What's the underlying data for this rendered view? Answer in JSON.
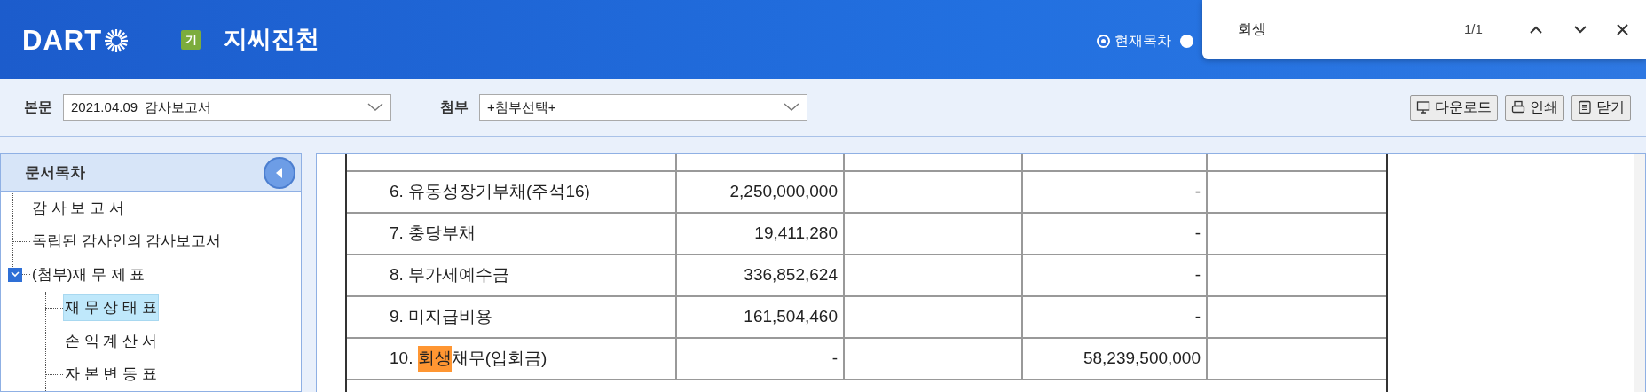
{
  "header": {
    "logo": "DART",
    "badge": "기",
    "company": "지씨진천",
    "toc_options": [
      {
        "label": "현재목차",
        "selected": true
      },
      {
        "selected": false
      }
    ]
  },
  "find_bar": {
    "query": "회생",
    "count": "1/1"
  },
  "toolbar": {
    "main_label": "본문",
    "main_value": "2021.04.09  감사보고서",
    "attach_label": "첨부",
    "attach_value": "+첨부선택+",
    "buttons": [
      {
        "kind": "download",
        "label": "다운로드"
      },
      {
        "kind": "print",
        "label": "인쇄"
      },
      {
        "kind": "close",
        "label": "닫기"
      }
    ]
  },
  "sidebar": {
    "title": "문서목차",
    "items": [
      {
        "label": "감 사 보 고 서",
        "selected": false
      },
      {
        "label": "독립된 감사인의 감사보고서",
        "selected": false
      },
      {
        "label": "(첨부)재 무 제 표",
        "selected": false,
        "expanded": true,
        "children": [
          {
            "label": "재 무 상 태 표",
            "selected": true
          },
          {
            "label": "손 익 계 산 서",
            "selected": false
          },
          {
            "label": "자 본 변 동 표",
            "selected": false
          }
        ]
      }
    ]
  },
  "table": {
    "rows": [
      {
        "label": [
          {
            "text": "6. 유동성장기부채(주석16)",
            "highlighted": false
          }
        ],
        "column_2": "2,250,000,000",
        "column_4": "-"
      },
      {
        "label": [
          {
            "text": "7. 충당부채",
            "highlighted": false
          }
        ],
        "column_2": "19,411,280",
        "column_4": "-"
      },
      {
        "label": [
          {
            "text": "8. 부가세예수금",
            "highlighted": false
          }
        ],
        "column_2": "336,852,624",
        "column_4": "-"
      },
      {
        "label": [
          {
            "text": "9. 미지급비용",
            "highlighted": false
          }
        ],
        "column_2": "161,504,460",
        "column_4": "-"
      },
      {
        "label": [
          {
            "text": "10. ",
            "highlighted": false
          },
          {
            "text": "회생",
            "highlighted": true
          },
          {
            "text": "채무(입회금)",
            "highlighted": false
          }
        ],
        "column_2": "-",
        "column_4": "58,239,500,000"
      }
    ]
  }
}
